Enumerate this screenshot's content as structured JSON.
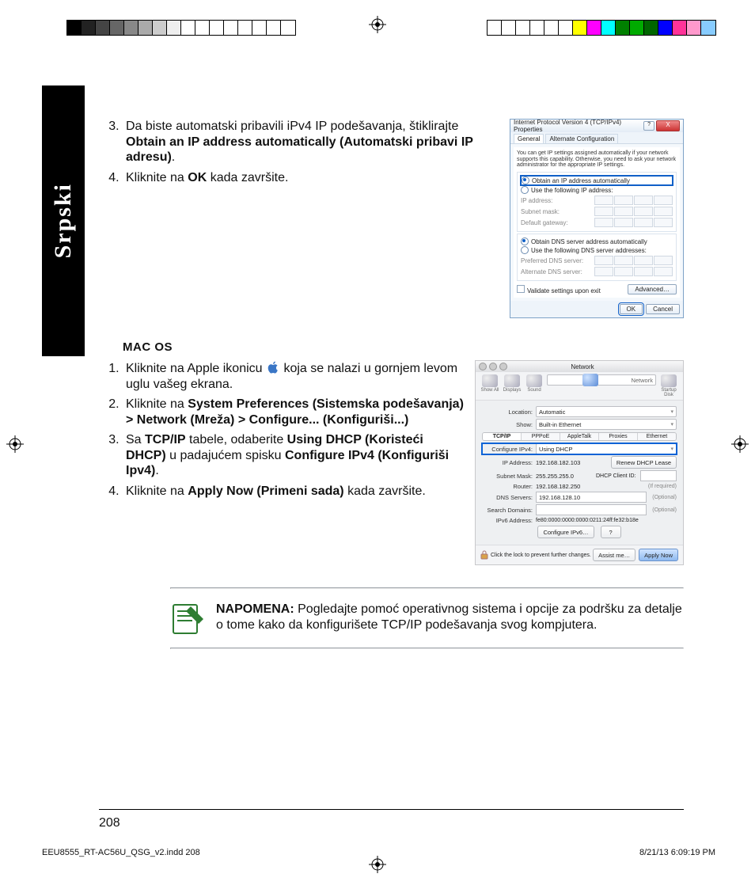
{
  "language_tab": "Srpski",
  "steps_top": {
    "start": 3,
    "items": [
      {
        "pre": "Da biste automatski pribavili iPv4 IP podešavanja, štiklirajte ",
        "bold": "Obtain an IP address automatically (Automatski pribavi IP adresu)",
        "post": "."
      },
      {
        "pre": "Kliknite na ",
        "bold": "OK",
        "post": " kada završite."
      }
    ]
  },
  "macos_heading": "MAC OS",
  "steps_mac": {
    "start": 1,
    "items": [
      {
        "parts": [
          {
            "t": "Kliknite na Apple ikonicu "
          },
          {
            "apple": true
          },
          {
            "t": " koja se nalazi u gornjem levom uglu vašeg ekrana."
          }
        ]
      },
      {
        "parts": [
          {
            "t": "Kliknite na "
          },
          {
            "b": "System Preferences (Sistemska podešavanja) > Network (Mreža) > Configure... (Konfiguriši...)"
          }
        ]
      },
      {
        "parts": [
          {
            "t": "Sa "
          },
          {
            "b": "TCP/IP"
          },
          {
            "t": " tabele, odaberite "
          },
          {
            "b": "Using DHCP (Koristeći DHCP)"
          },
          {
            "t": " u padajućem spisku "
          },
          {
            "b": "Configure IPv4 (Konfiguriši Ipv4)"
          },
          {
            "t": "."
          }
        ]
      },
      {
        "parts": [
          {
            "t": "Kliknite na "
          },
          {
            "b": "Apply Now (Primeni sada)"
          },
          {
            "t": " kada završite."
          }
        ]
      }
    ]
  },
  "note_label": "NAPOMENA:",
  "note_text": " Pogledajte pomoć operativnog sistema i opcije za podršku za detalje o tome kako da konfigurišete TCP/IP podešavanja svog kompjutera.",
  "page_number": "208",
  "footer_file": "EEU8555_RT-AC56U_QSG_v2.indd   208",
  "footer_time": "8/21/13   6:09:19 PM",
  "win": {
    "title": "Internet Protocol Version 4 (TCP/IPv4) Properties",
    "close_hint": "?  X",
    "tab1": "General",
    "tab2": "Alternate Configuration",
    "help": "You can get IP settings assigned automatically if your network supports this capability. Otherwise, you need to ask your network administrator for the appropriate IP settings.",
    "r1": "Obtain an IP address automatically",
    "r2": "Use the following IP address:",
    "f_ip": "IP address:",
    "f_sub": "Subnet mask:",
    "f_gw": "Default gateway:",
    "r3": "Obtain DNS server address automatically",
    "r4": "Use the following DNS server addresses:",
    "f_pdns": "Preferred DNS server:",
    "f_adns": "Alternate DNS server:",
    "chk": "Validate settings upon exit",
    "adv": "Advanced…",
    "ok": "OK",
    "cancel": "Cancel"
  },
  "mac": {
    "title": "Network",
    "tools": [
      "Show All",
      "Displays",
      "Sound",
      "Network",
      "Startup Disk"
    ],
    "loc_lbl": "Location:",
    "loc_val": "Automatic",
    "show_lbl": "Show:",
    "show_val": "Built-in Ethernet",
    "tabs": [
      "TCP/IP",
      "PPPoE",
      "AppleTalk",
      "Proxies",
      "Ethernet"
    ],
    "cfg_lbl": "Configure IPv4:",
    "cfg_val": "Using DHCP",
    "ip_lbl": "IP Address:",
    "ip_val": "192.168.182.103",
    "renew": "Renew DHCP Lease",
    "sm_lbl": "Subnet Mask:",
    "sm_val": "255.255.255.0",
    "cid_lbl": "DHCP Client ID:",
    "cid_hint": "(If required)",
    "rt_lbl": "Router:",
    "rt_val": "192.168.182.250",
    "dns_lbl": "DNS Servers:",
    "dns_val": "192.168.128.10",
    "sd_lbl": "Search Domains:",
    "v6_lbl": "IPv6 Address:",
    "v6_val": "fe80:0000:0000:0000:0211:24ff:fe32:b18e",
    "cfgv6": "Configure IPv6…",
    "lock": "Click the lock to prevent further changes.",
    "assist": "Assist me…",
    "apply": "Apply Now",
    "optional": "(Optional)"
  },
  "swatches_left": [
    "#000",
    "#222",
    "#444",
    "#666",
    "#888",
    "#aaa",
    "#ccc",
    "#eee",
    "#fff",
    "#fff",
    "#fff",
    "#fff",
    "#fff",
    "#fff",
    "#fff",
    "#fff"
  ],
  "swatches_right": [
    "#fff",
    "#fff",
    "#fff",
    "#fff",
    "#fff",
    "#fff",
    "#ff0",
    "#f0f",
    "#0ff",
    "#008000",
    "#0a0",
    "#060",
    "#00f",
    "#f39",
    "#f9c",
    "#8cf"
  ]
}
